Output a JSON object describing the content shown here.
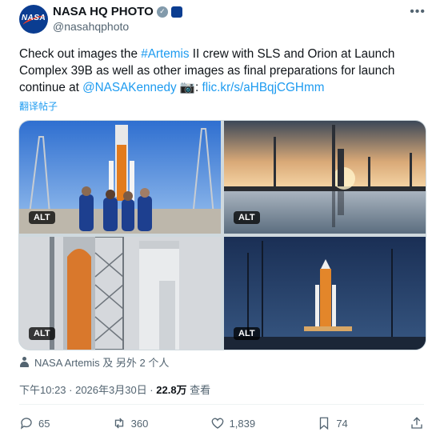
{
  "author": {
    "display_name": "NASA HQ PHOTO",
    "handle": "@nasahqphoto",
    "avatar_text": "NASA"
  },
  "tweet": {
    "p1": "Check out images the ",
    "hashtag": "#Artemis",
    "p2": " II crew with SLS and Orion at Launch Complex 39B as well as other images as final preparations for launch continue at ",
    "mention": "@NASAKennedy",
    "camera": "📷",
    "p3": ": ",
    "url": "flic.kr/s/aHBqjCGHmm"
  },
  "translate_label": "翻译帖子",
  "media": {
    "alt_labels": [
      "ALT",
      "ALT",
      "ALT",
      "ALT"
    ]
  },
  "tagged_text": "NASA Artemis 及 另外 2 个人",
  "meta": {
    "time": "下午10:23 · 2026年3月30日 · ",
    "views": "22.8万",
    "views_label": " 查看"
  },
  "actions": {
    "replies": "65",
    "reposts": "360",
    "likes": "1,839",
    "bookmarks": "74"
  },
  "colors": {
    "accent": "#1d9bf0",
    "text": "#0f1419",
    "muted": "#536471"
  }
}
